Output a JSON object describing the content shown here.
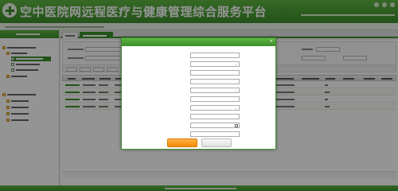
{
  "app": {
    "title": "空中医院网远程医疗与健康管理综合服务平台",
    "brand_color": "#3c8f2a",
    "accent_color": "#f08a00"
  },
  "header": {
    "icons": [
      "home-icon",
      "settings-icon",
      "logout-icon"
    ]
  },
  "modal": {
    "title": "",
    "close_glyph": "×",
    "fields": [
      {
        "label": "",
        "type": "text",
        "value": ""
      },
      {
        "label": "",
        "type": "select",
        "value": ""
      },
      {
        "label": "",
        "type": "text",
        "value": ""
      },
      {
        "label": "",
        "type": "text",
        "value": ""
      },
      {
        "label": "",
        "type": "select",
        "value": ""
      },
      {
        "label": "",
        "type": "text",
        "value": ""
      },
      {
        "label": "",
        "type": "select",
        "value": ""
      },
      {
        "label": "",
        "type": "text",
        "value": ""
      },
      {
        "label": "",
        "type": "date",
        "value": ""
      },
      {
        "label": "",
        "type": "text",
        "value": ""
      }
    ],
    "submit_label": "",
    "cancel_label": ""
  }
}
